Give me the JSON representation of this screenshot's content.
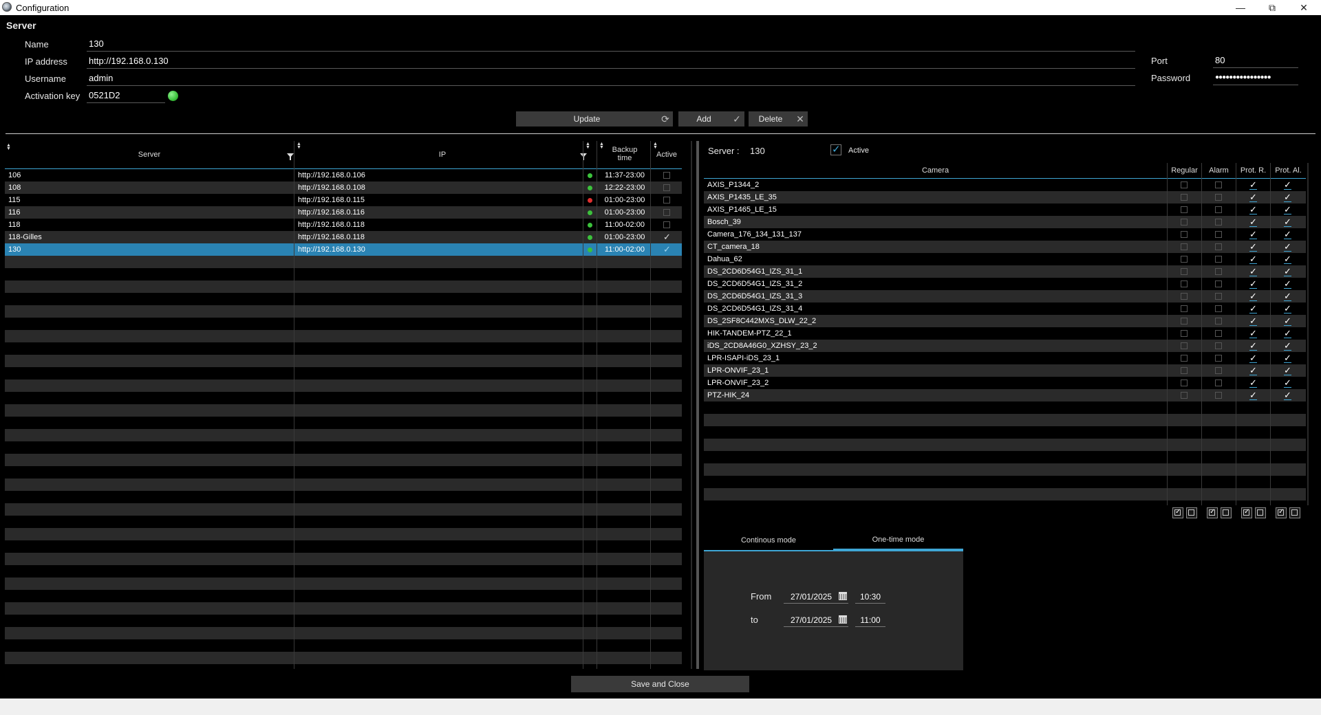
{
  "window": {
    "title": "Configuration"
  },
  "server_section": {
    "title": "Server",
    "name_label": "Name",
    "name_value": "130",
    "ip_label": "IP address",
    "ip_value": "http://192.168.0.130",
    "username_label": "Username",
    "username_value": "admin",
    "activation_label": "Activation key",
    "activation_value": "0521D2",
    "port_label": "Port",
    "port_value": "80",
    "password_label": "Password",
    "password_value": "●●●●●●●●●●●●●●●●",
    "activation_status_color": "#3cc13c"
  },
  "buttons": {
    "update": "Update",
    "add": "Add",
    "delete": "Delete",
    "save_close": "Save and Close"
  },
  "servers_table": {
    "headers": {
      "server": "Server",
      "ip": "IP",
      "backup_line1": "Backup",
      "backup_line2": "time",
      "active": "Active"
    },
    "rows": [
      {
        "server": "106",
        "ip": "http://192.168.0.106",
        "status": "green",
        "backup": "11:37-23:00",
        "active": false,
        "selected": false
      },
      {
        "server": "108",
        "ip": "http://192.168.0.108",
        "status": "green",
        "backup": "12:22-23:00",
        "active": false,
        "selected": false
      },
      {
        "server": "115",
        "ip": "http://192.168.0.115",
        "status": "red",
        "backup": "01:00-23:00",
        "active": false,
        "selected": false
      },
      {
        "server": "116",
        "ip": "http://192.168.0.116",
        "status": "green",
        "backup": "01:00-23:00",
        "active": false,
        "selected": false
      },
      {
        "server": "118",
        "ip": "http://192.168.0.118",
        "status": "green",
        "backup": "11:00-02:00",
        "active": false,
        "selected": false
      },
      {
        "server": "118-Gilles",
        "ip": "http://192.168.0.118",
        "status": "green",
        "backup": "01:00-23:00",
        "active": true,
        "selected": false
      },
      {
        "server": "130",
        "ip": "http://192.168.0.130",
        "status": "green",
        "backup": "11:00-02:00",
        "active": true,
        "selected": true
      }
    ],
    "status_colors": {
      "green": "#3cc13c",
      "red": "#e03030"
    },
    "selected_color": "#2a83b3"
  },
  "camera_panel": {
    "server_label": "Server :",
    "server_value": "130",
    "active_label": "Active",
    "active_checked": true,
    "headers": {
      "camera": "Camera",
      "regular": "Regular",
      "alarm": "Alarm",
      "prot_r": "Prot. R.",
      "prot_al": "Prot. Al."
    },
    "cameras": [
      {
        "name": "AXIS_P1344_2",
        "regular": false,
        "alarm": false,
        "prot_r": true,
        "prot_al": true
      },
      {
        "name": "AXIS_P1435_LE_35",
        "regular": false,
        "alarm": false,
        "prot_r": true,
        "prot_al": true
      },
      {
        "name": "AXIS_P1465_LE_15",
        "regular": false,
        "alarm": false,
        "prot_r": true,
        "prot_al": true
      },
      {
        "name": "Bosch_39",
        "regular": false,
        "alarm": false,
        "prot_r": true,
        "prot_al": true
      },
      {
        "name": "Camera_176_134_131_137",
        "regular": false,
        "alarm": false,
        "prot_r": true,
        "prot_al": true
      },
      {
        "name": "CT_camera_18",
        "regular": false,
        "alarm": false,
        "prot_r": true,
        "prot_al": true
      },
      {
        "name": "Dahua_62",
        "regular": false,
        "alarm": false,
        "prot_r": true,
        "prot_al": true
      },
      {
        "name": "DS_2CD6D54G1_IZS_31_1",
        "regular": false,
        "alarm": false,
        "prot_r": true,
        "prot_al": true
      },
      {
        "name": "DS_2CD6D54G1_IZS_31_2",
        "regular": false,
        "alarm": false,
        "prot_r": true,
        "prot_al": true
      },
      {
        "name": "DS_2CD6D54G1_IZS_31_3",
        "regular": false,
        "alarm": false,
        "prot_r": true,
        "prot_al": true
      },
      {
        "name": "DS_2CD6D54G1_IZS_31_4",
        "regular": false,
        "alarm": false,
        "prot_r": true,
        "prot_al": true
      },
      {
        "name": "DS_2SF8C442MXS_DLW_22_2",
        "regular": false,
        "alarm": false,
        "prot_r": true,
        "prot_al": true
      },
      {
        "name": "HIK-TANDEM-PTZ_22_1",
        "regular": false,
        "alarm": false,
        "prot_r": true,
        "prot_al": true
      },
      {
        "name": "iDS_2CD8A46G0_XZHSY_23_2",
        "regular": false,
        "alarm": false,
        "prot_r": true,
        "prot_al": true
      },
      {
        "name": "LPR-ISAPI-iDS_23_1",
        "regular": false,
        "alarm": false,
        "prot_r": true,
        "prot_al": true
      },
      {
        "name": "LPR-ONVIF_23_1",
        "regular": false,
        "alarm": false,
        "prot_r": true,
        "prot_al": true
      },
      {
        "name": "LPR-ONVIF_23_2",
        "regular": false,
        "alarm": false,
        "prot_r": true,
        "prot_al": true
      },
      {
        "name": "PTZ-HIK_24",
        "regular": false,
        "alarm": false,
        "prot_r": true,
        "prot_al": true
      }
    ]
  },
  "mode_panel": {
    "tabs": [
      "Continous mode",
      "One-time mode"
    ],
    "active_tab": "One-time mode",
    "from_label": "From",
    "from_date": "27/01/2025",
    "from_time": "10:30",
    "to_label": "to",
    "to_date": "27/01/2025",
    "to_time": "11:00"
  },
  "colors": {
    "accent": "#3fa7d6",
    "row_alt": "#2a2a2a",
    "row": "#000000"
  }
}
